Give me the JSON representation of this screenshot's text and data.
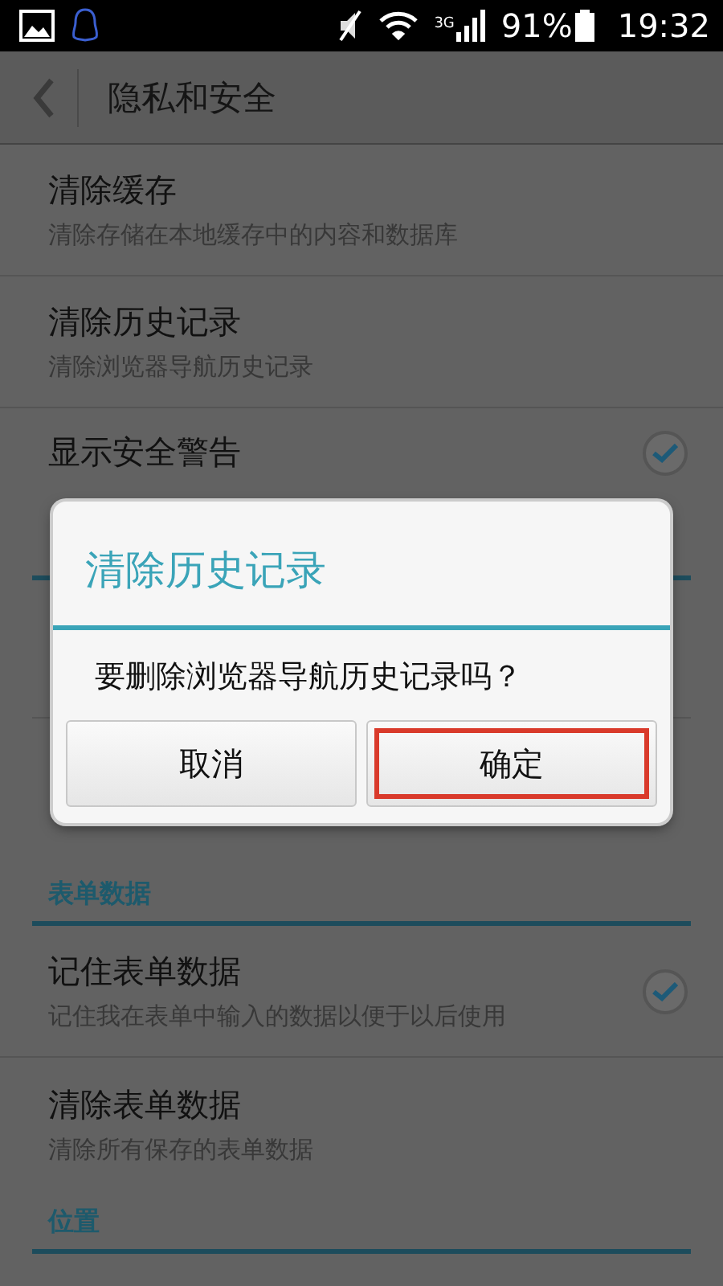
{
  "status_bar": {
    "network": "3G",
    "battery": "91%",
    "time": "19:32"
  },
  "app_bar": {
    "title": "隐私和安全"
  },
  "top_items": [
    {
      "kind": "action",
      "title": "清除缓存",
      "summary": "清除存储在本地缓存中的内容和数据库"
    },
    {
      "kind": "action",
      "title": "清除历史记录",
      "summary": "清除浏览器导航历史记录"
    },
    {
      "kind": "checkbox",
      "title": "显示安全警告",
      "checked": true
    }
  ],
  "lower_sections": [
    {
      "header": "表单数据",
      "items": [
        {
          "kind": "checkbox",
          "title": "记住表单数据",
          "summary": "记住我在表单中输入的数据以便于以后使用",
          "checked": true
        },
        {
          "kind": "action",
          "title": "清除表单数据",
          "summary": "清除所有保存的表单数据"
        }
      ]
    },
    {
      "header": "位置"
    }
  ],
  "dialog": {
    "title": "清除历史记录",
    "message": "要删除浏览器导航历史记录吗？",
    "buttons": [
      {
        "label": "取消",
        "highlighted": false
      },
      {
        "label": "确定",
        "highlighted": true
      }
    ]
  }
}
